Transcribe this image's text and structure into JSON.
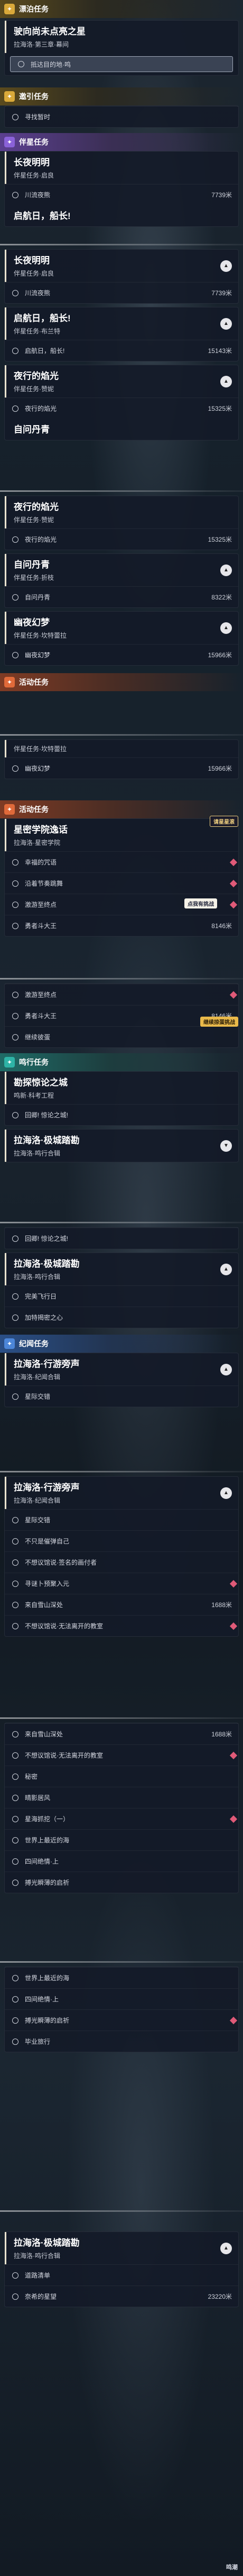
{
  "colors": {
    "gold": "#d9a93a",
    "blue": "#4d7fd9",
    "purple": "#8a62d8",
    "orange": "#e06a3a",
    "teal": "#2eb3a6",
    "marker": "#e05a78"
  },
  "sections": {
    "s1": {
      "icon": "✦",
      "title": "漂泊任务"
    },
    "s2": {
      "icon": "✦",
      "title": "邀引任务"
    },
    "s3": {
      "icon": "✦",
      "title": "伴星任务"
    },
    "s4": {
      "icon": "✦",
      "title": "活动任务"
    },
    "s5": {
      "icon": "✦",
      "title": "活动任务"
    },
    "s6": {
      "icon": "✦",
      "title": "鸣行任务"
    },
    "s7": {
      "icon": "✦",
      "title": "纪闻任务"
    }
  },
  "q1": {
    "title": "驶向尚未点亮之星",
    "sub": "拉海洛·第三章·幕间",
    "step": "抵达目的地·鸣"
  },
  "q2": {
    "step": "寻找暂时"
  },
  "q3": {
    "title": "长夜明明",
    "sub": "伴星任务·启良",
    "step": "川流夜熊",
    "dist": "7739米"
  },
  "q3b": {
    "title": "启航日，船长!",
    "sub": ""
  },
  "q4": {
    "title": "长夜明明",
    "sub": "伴星任务·启良",
    "step": "川流夜熊",
    "dist": "7739米"
  },
  "q5": {
    "title": "启航日，船长!",
    "sub": "伴星任务·布兰特",
    "step": "启航日，船长!",
    "dist": "15143米"
  },
  "q6": {
    "title": "夜行的焰光",
    "sub": "伴星任务·赞妮",
    "step": "夜行的焰光",
    "dist": "15325米"
  },
  "q7": {
    "title": "自问丹青"
  },
  "q8": {
    "title": "夜行的焰光",
    "sub": "伴星任务·赞妮",
    "step": "夜行的焰光",
    "dist": "15325米"
  },
  "q9": {
    "title": "自问丹青",
    "sub": "伴星任务·折枝",
    "step": "自问丹青",
    "dist": "8322米"
  },
  "q10": {
    "title": "幽夜幻梦",
    "sub": "伴星任务·坎特蕾拉",
    "step": "幽夜幻梦",
    "dist": "15966米"
  },
  "q11": {
    "sub": "伴星任务·坎特蕾拉",
    "step": "幽夜幻梦",
    "dist": "15966米"
  },
  "q12": {
    "title": "星密学院逸话",
    "sub": "拉海洛·星密学院",
    "steps": [
      "幸福的咒语",
      "沿着节奏跳舞",
      "激游至终点",
      "勇者斗大王"
    ],
    "dist": "8146米",
    "bubble": "请星星滚"
  },
  "float1": "点我有挑战",
  "q13": {
    "steps": [
      "激游至终点",
      "勇者斗大王",
      "继续彼蛋"
    ],
    "dist": "8146米",
    "bubble": "继续掠蛋挑战"
  },
  "q14": {
    "title": "勘探惊论之城",
    "sub": "鸣新·科考工程",
    "step": "回卿! 惊论之城!"
  },
  "q15": {
    "title": "拉海洛·极城踏勘",
    "sub": "拉海洛·鸣行合辑"
  },
  "q16": {
    "step": "回卿! 惊论之城!"
  },
  "q17": {
    "title": "拉海洛·极城踏勘",
    "sub": "拉海洛·鸣行合辑",
    "steps": [
      "完美飞行日",
      "加特揭密之心"
    ]
  },
  "q18": {
    "title": "拉海洛·行游旁声",
    "sub": "拉海洛·纪闻合辑",
    "step": "星际交错"
  },
  "q19": {
    "title": "拉海洛·行游旁声",
    "sub": "拉海洛·纪闻合辑",
    "steps": [
      "星际交错",
      "不只是催弹自己",
      "不想议馆说·签名的画付者",
      "寻谜卜预聚入元",
      "来自雪山深处",
      "不想议馆说·无法离开的教室"
    ],
    "dist": "1688米"
  },
  "q20": {
    "steps": [
      "来自雪山深处",
      "不想议馆说·无法离开的教室",
      "秘密",
      "晴影居风",
      "星海抓挖（一）",
      "世界上最近的海",
      "四间绝情·上",
      "搏光瞬薄的启祈"
    ],
    "dist": "1688米"
  },
  "q21": {
    "steps": [
      "世界上最近的海",
      "四间绝情·上",
      "搏光瞬薄的启祈",
      "毕业旅行"
    ]
  },
  "q22": {
    "title": "拉海洛·极城踏勘",
    "sub": "拉海洛·鸣行合辑",
    "steps": [
      "道路清单",
      "奈希的星望"
    ],
    "dist": "23220米"
  },
  "watermark": "鸣潮"
}
